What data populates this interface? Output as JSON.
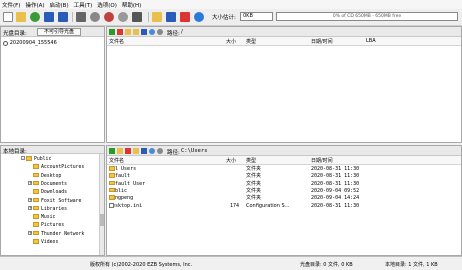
{
  "menu": [
    "文件(F)",
    "操作(A)",
    "启动(B)",
    "工具(T)",
    "选项(O)",
    "帮助(H)"
  ],
  "toolbar": {
    "size_label": "大小估计:",
    "size_value": "0KB",
    "capacity_text": "0% of CD 650MB - 650MB free"
  },
  "disc_panel": {
    "label": "光盘目录:",
    "button": "不可引导光盘",
    "tree_root": "20200904_155546",
    "path_label": "路径:",
    "path_value": "/",
    "columns": [
      "文件名",
      "大小",
      "类型",
      "日期/时间",
      "LBA"
    ]
  },
  "local_panel": {
    "label": "本地目录:",
    "path_label": "路径:",
    "path_value": "C:\\Users",
    "tree": [
      {
        "name": "Public",
        "indent": 0,
        "exp": "-"
      },
      {
        "name": "AccountPictures",
        "indent": 1,
        "exp": ""
      },
      {
        "name": "Desktop",
        "indent": 1,
        "exp": ""
      },
      {
        "name": "Documents",
        "indent": 1,
        "exp": "+"
      },
      {
        "name": "Downloads",
        "indent": 1,
        "exp": ""
      },
      {
        "name": "Foxit Software",
        "indent": 1,
        "exp": "+"
      },
      {
        "name": "Libraries",
        "indent": 1,
        "exp": "+"
      },
      {
        "name": "Music",
        "indent": 1,
        "exp": ""
      },
      {
        "name": "Pictures",
        "indent": 1,
        "exp": ""
      },
      {
        "name": "Thunder Network",
        "indent": 1,
        "exp": "+"
      },
      {
        "name": "Videos",
        "indent": 1,
        "exp": ""
      }
    ],
    "columns": [
      "文件名",
      "大小",
      "类型",
      "日期/时间"
    ],
    "files": [
      {
        "name": "All Users",
        "size": "",
        "type": "文件夹",
        "date": "2020-08-31 11:30",
        "icon": "folder"
      },
      {
        "name": "Default",
        "size": "",
        "type": "文件夹",
        "date": "2020-08-31 11:30",
        "icon": "folder"
      },
      {
        "name": "Default User",
        "size": "",
        "type": "文件夹",
        "date": "2020-08-31 11:30",
        "icon": "folder"
      },
      {
        "name": "Public",
        "size": "",
        "type": "文件夹",
        "date": "2020-09-04 09:52",
        "icon": "folder"
      },
      {
        "name": "wangpeng",
        "size": "",
        "type": "文件夹",
        "date": "2020-09-04 14:24",
        "icon": "folder"
      },
      {
        "name": "desktop.ini",
        "size": "174",
        "type": "Configuration S...",
        "date": "2020-08-31 11:30",
        "icon": "file"
      }
    ]
  },
  "status": {
    "copyright": "版权所有 (c)2002-2020 EZB Systems, Inc.",
    "disc_stats": "光盘目录: 0 文件, 0 KB",
    "local_stats": "本地目录: 1 文件, 1 KB"
  }
}
